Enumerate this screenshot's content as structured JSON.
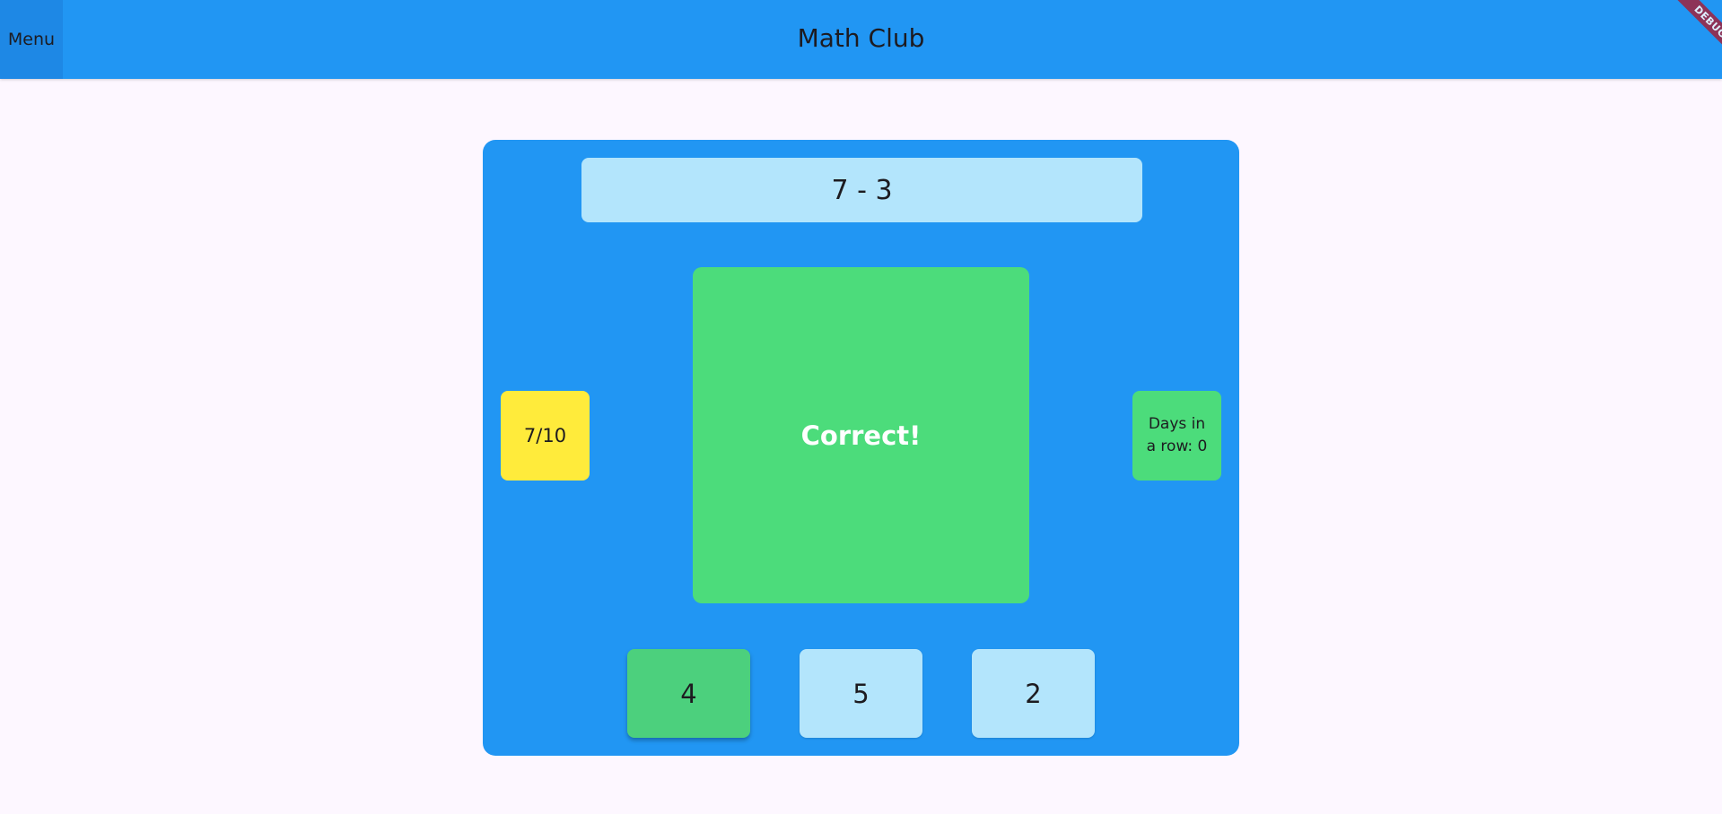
{
  "app_bar": {
    "menu_label": "Menu",
    "title": "Math Club",
    "debug_label": "DEBUG"
  },
  "game": {
    "question": "7 - 3",
    "score": "7/10",
    "result": "Correct!",
    "streak": "Days in a row: 0",
    "answers": [
      {
        "label": "4",
        "selected": true
      },
      {
        "label": "5",
        "selected": false
      },
      {
        "label": "2",
        "selected": false
      }
    ]
  },
  "colors": {
    "primary": "#2196f3",
    "question_bg": "#b3e5fc",
    "score_bg": "#ffeb3b",
    "correct_bg": "#4cdc7b",
    "selected_answer_bg": "#4cd07d",
    "page_bg": "#fdf7ff",
    "debug_ribbon": "#a0223d"
  }
}
